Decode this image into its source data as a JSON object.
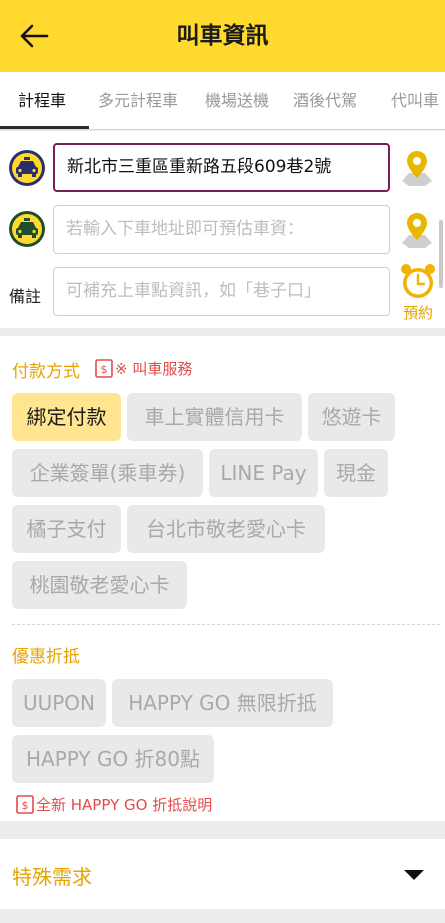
{
  "header": {
    "title": "叫車資訊"
  },
  "tabs": [
    {
      "label": "計程車"
    },
    {
      "label": "多元計程車"
    },
    {
      "label": "機場送機"
    },
    {
      "label": "酒後代駕"
    },
    {
      "label": "代叫車"
    }
  ],
  "address": {
    "pickup_value": "新北市三重區重新路五段609巷2號",
    "dropoff_placeholder": "若輸入下車地址即可預估車資：",
    "note_label": "備註",
    "note_placeholder": "可補充上車點資訊，如「巷子口」",
    "reserve_label": "預約"
  },
  "payment": {
    "title": "付款方式",
    "service_link": "※ 叫車服務",
    "options": [
      {
        "label": "綁定付款",
        "selected": true
      },
      {
        "label": "車上實體信用卡",
        "selected": false
      },
      {
        "label": "悠遊卡",
        "selected": false
      },
      {
        "label": "企業簽單(乘車券)",
        "selected": false
      },
      {
        "label": "LINE Pay",
        "selected": false
      },
      {
        "label": "現金",
        "selected": false
      },
      {
        "label": "橘子支付",
        "selected": false
      },
      {
        "label": "台北市敬老愛心卡",
        "selected": false
      },
      {
        "label": "桃園敬老愛心卡",
        "selected": false
      }
    ]
  },
  "discount": {
    "title": "優惠折抵",
    "options": [
      {
        "label": "UUPON"
      },
      {
        "label": "HAPPY GO 無限折抵"
      },
      {
        "label": "HAPPY GO 折80點"
      }
    ],
    "info_link": "全新 HAPPY GO 折抵說明"
  },
  "special": {
    "title": "特殊需求"
  },
  "colors": {
    "brand_yellow": "#ffd92e",
    "accent_orange": "#e6a400",
    "link_red": "#e34b4b",
    "selected_chip": "#ffe58f",
    "pickup_border": "#7a1f55"
  }
}
